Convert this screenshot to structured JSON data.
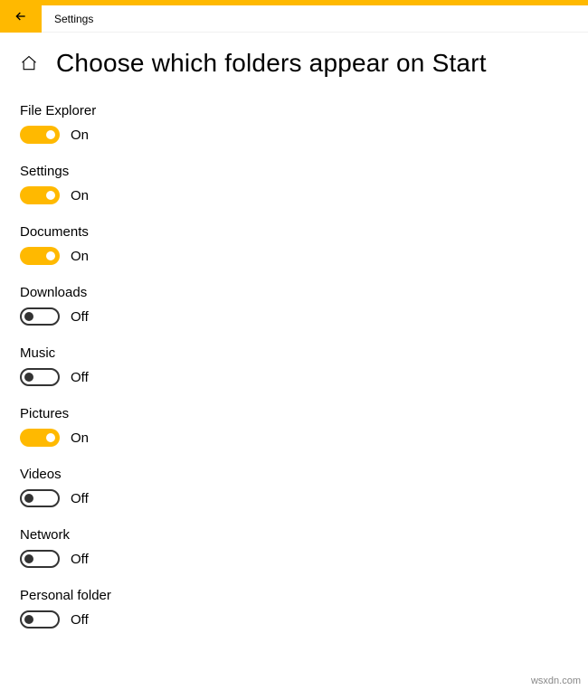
{
  "titlebar": {
    "title": "Settings"
  },
  "page": {
    "title": "Choose which folders appear on Start"
  },
  "states": {
    "on": "On",
    "off": "Off"
  },
  "colors": {
    "accent": "#ffb900"
  },
  "settings": [
    {
      "label": "File Explorer",
      "on": true
    },
    {
      "label": "Settings",
      "on": true
    },
    {
      "label": "Documents",
      "on": true
    },
    {
      "label": "Downloads",
      "on": false
    },
    {
      "label": "Music",
      "on": false
    },
    {
      "label": "Pictures",
      "on": true
    },
    {
      "label": "Videos",
      "on": false
    },
    {
      "label": "Network",
      "on": false
    },
    {
      "label": "Personal folder",
      "on": false
    }
  ],
  "watermark": "wsxdn.com"
}
